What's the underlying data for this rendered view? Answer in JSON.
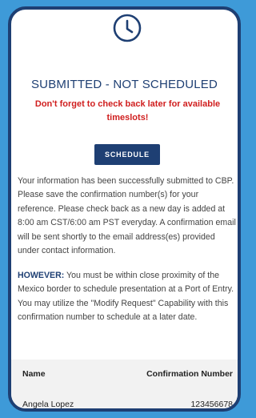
{
  "status": {
    "icon": "clock-icon",
    "title": "SUBMITTED - NOT SCHEDULED",
    "warning": "Don't forget to check back later for available timeslots!"
  },
  "schedule_button": {
    "label": "SCHEDULE"
  },
  "info_text": "Your information has been successfully submitted to CBP. Please save the confirmation number(s) for your reference. Please check back as a new day is added at 8:00 am CST/6:00 am PST everyday. A confirmation email will be sent shortly to the email address(es) provided under contact information.",
  "however": {
    "label": "HOWEVER:",
    "text": " You must be within close proximity of the Mexico border to schedule presentation at a Port of Entry.  You may utilize the \"Modify Request\" Capability with this confirmation number to schedule at a later date."
  },
  "table": {
    "headers": {
      "name": "Name",
      "confirmation": "Confirmation Number"
    },
    "rows": [
      {
        "name": "Angela Lopez",
        "confirmation": "123456678"
      }
    ]
  },
  "colors": {
    "background": "#3e9ad8",
    "navy": "#1e3f73",
    "warning_red": "#d01e1e"
  }
}
